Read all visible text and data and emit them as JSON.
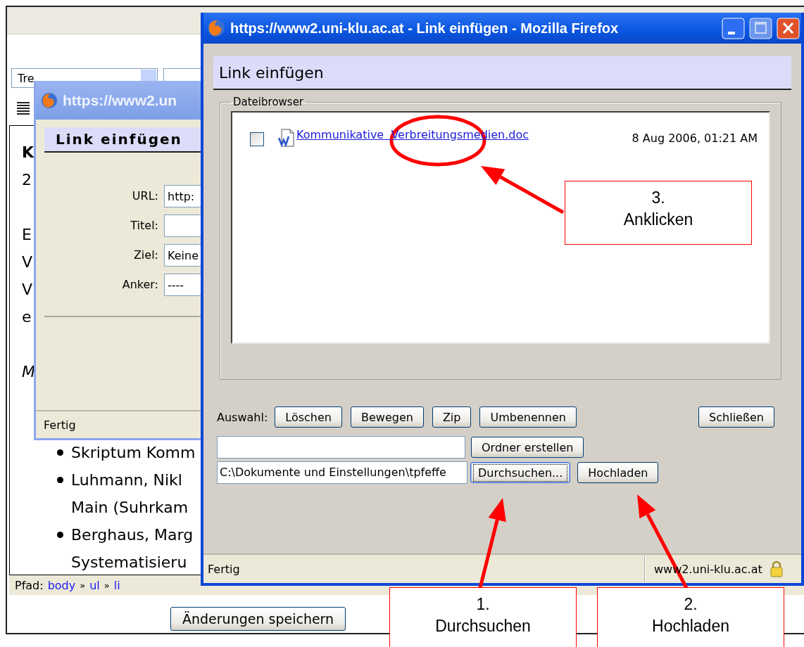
{
  "editor_page": {
    "font_select": "Tre",
    "content_lines": [
      "K",
      "2",
      "E",
      "V",
      "V",
      "e",
      "M"
    ],
    "bullets": [
      {
        "lines": [
          "Skriptum Komm"
        ]
      },
      {
        "lines": [
          "Luhmann, Nikl",
          "Main (Suhrkam"
        ]
      },
      {
        "lines": [
          "Berghaus, Marg",
          "Systematisieru"
        ]
      }
    ],
    "path_label": "Pfad:",
    "path": [
      {
        "kind": "link",
        "text": "body"
      },
      {
        "kind": "separator",
        "text": "»"
      },
      {
        "kind": "link",
        "text": "ul"
      },
      {
        "kind": "separator",
        "text": "»"
      },
      {
        "kind": "link",
        "text": "li"
      }
    ],
    "save_button": "Änderungen speichern"
  },
  "back_dialog": {
    "title": "https://www2.un",
    "header": "Link einfügen",
    "fields": [
      {
        "label": "URL:",
        "value": "http:"
      },
      {
        "label": "Titel:"
      },
      {
        "label": "Ziel:",
        "value": "Keine"
      },
      {
        "label": "Anker:",
        "value": "----"
      }
    ],
    "status": "Fertig"
  },
  "file_dialog": {
    "title": "https://www2.uni-klu.ac.at - Link einfügen - Mozilla Firefox",
    "header": "Link einfügen",
    "legend": "Dateibrowser",
    "files": [
      {
        "checked": false,
        "name": "Kommunikative  Verbreitungsmedien.doc",
        "date": "8 Aug 2006, 01:21 AM"
      }
    ],
    "selection_label": "Auswahl:",
    "selection_buttons": [
      "Löschen",
      "Bewegen",
      "Zip",
      "Umbenennen"
    ],
    "close_button": "Schließen",
    "create_folder_button": "Ordner erstellen",
    "upload_path": "C:\\Dokumente und Einstellungen\\tpfeffe",
    "browse_button": {
      "label": "Durchsuchen...",
      "focused": true
    },
    "upload_button": "Hochladen",
    "status": "Fertig",
    "status_url": "www2.uni-klu.ac.at"
  },
  "annotations": {
    "callouts": [
      {
        "number": "3.",
        "text": "Anklicken"
      },
      {
        "number": "1.",
        "text": "Durchsuchen"
      },
      {
        "number": "2.",
        "text": "Hochladen"
      }
    ]
  }
}
